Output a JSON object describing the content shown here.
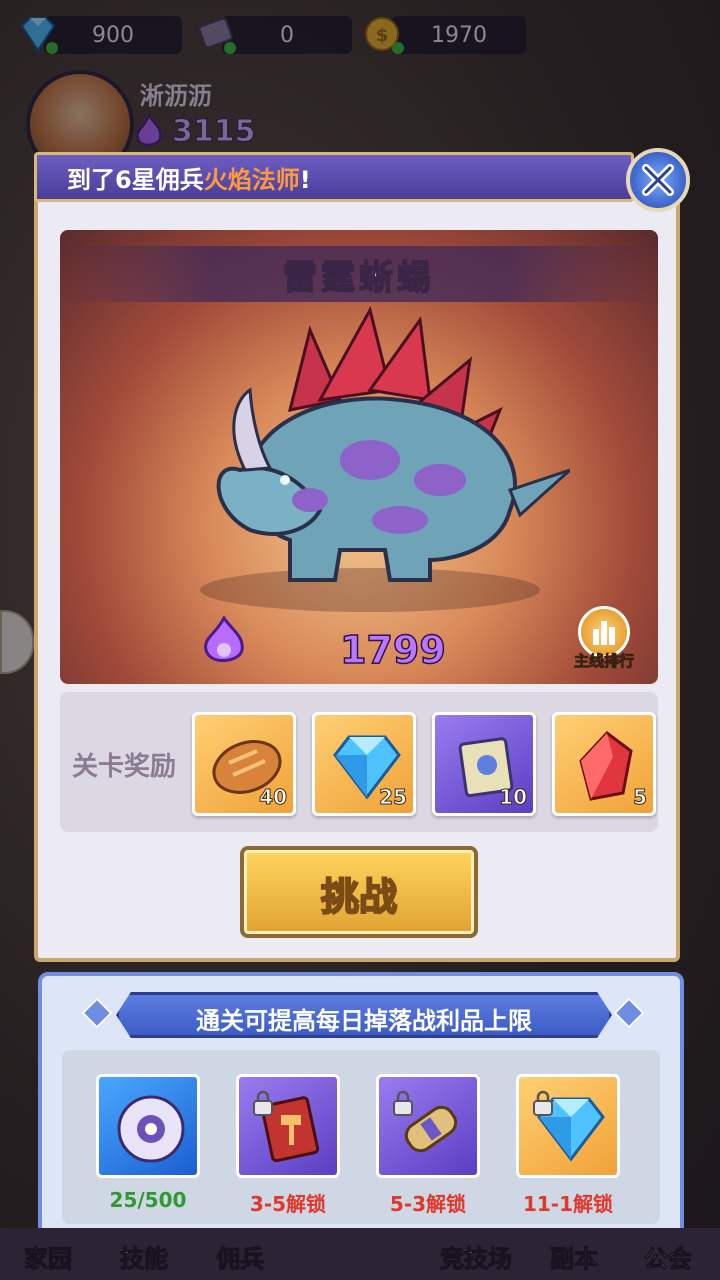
{
  "resources": [
    {
      "icon": "diamond-icon",
      "value": "900"
    },
    {
      "icon": "scroll-ticket-icon",
      "value": "0"
    },
    {
      "icon": "gold-coin-icon",
      "value": "1970"
    }
  ],
  "player": {
    "name": "淅沥沥",
    "power": "3115",
    "power_icon": "flame-icon"
  },
  "modal": {
    "marquee_prefix": "到了6星佣兵",
    "marquee_highlight": "火焰法师",
    "marquee_suffix": "!",
    "boss_name": "雷霆蜥蜴",
    "boss_power": "1799",
    "rank_label": "主线排行",
    "rewards_label": "关卡奖励",
    "rewards": [
      {
        "icon": "bread-icon",
        "count": "40",
        "rarity": "gold"
      },
      {
        "icon": "diamond-icon",
        "count": "25",
        "rarity": "gold"
      },
      {
        "icon": "scroll-icon",
        "count": "10",
        "rarity": "purple"
      },
      {
        "icon": "red-crystal-icon",
        "count": "5",
        "rarity": "gold"
      }
    ],
    "challenge_label": "挑战"
  },
  "panel": {
    "title": "通关可提高每日掉落战利品上限",
    "items": [
      {
        "icon": "saw-disc-icon",
        "label": "25/500",
        "status": "progress",
        "locked": false
      },
      {
        "icon": "hammer-book-icon",
        "label": "3-5解锁",
        "status": "locked",
        "locked": true
      },
      {
        "icon": "scroll-icon",
        "label": "5-3解锁",
        "status": "locked",
        "locked": true
      },
      {
        "icon": "diamond-icon",
        "label": "11-1解锁",
        "status": "locked",
        "locked": true
      }
    ]
  },
  "nav": [
    "家园",
    "技能",
    "佣兵",
    "竞技场",
    "副本",
    "公会"
  ],
  "colors": {
    "accent_purple": "#4a3d98",
    "challenge_gold": "#e0a234",
    "panel_blue": "#6f8de3",
    "progress_green": "#2f9a2f",
    "locked_red": "#e0392b"
  }
}
